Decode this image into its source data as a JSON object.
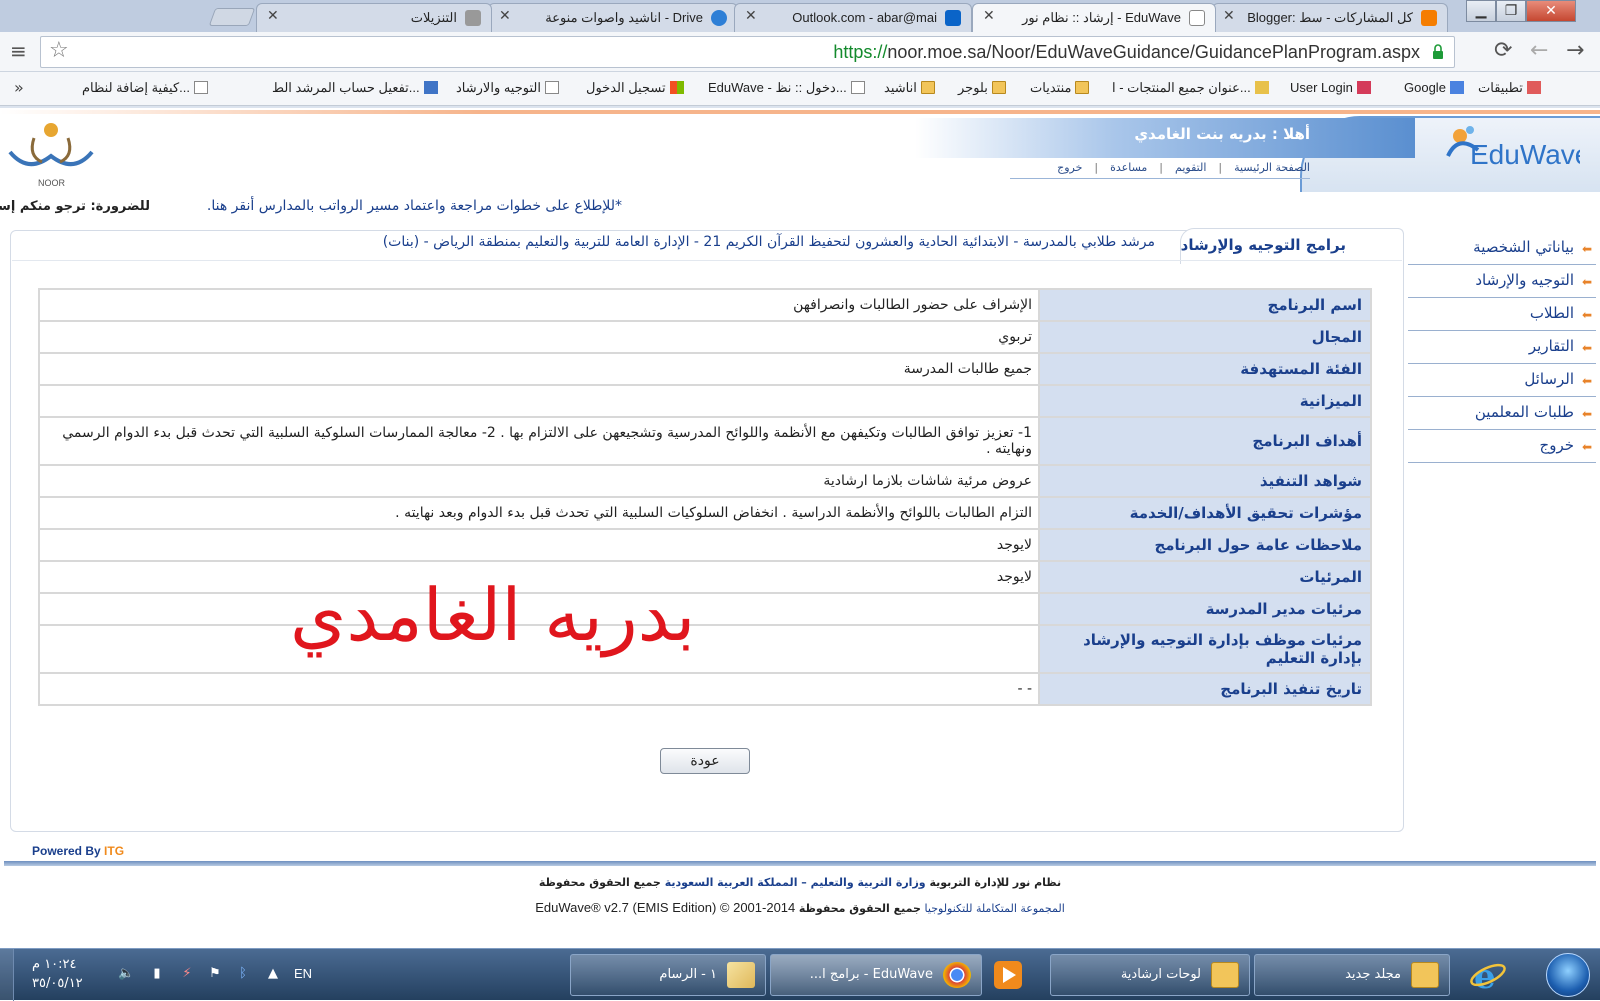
{
  "browser": {
    "tabs": [
      {
        "title": "Blogger: كل المشاركات - سط",
        "favicon_color": "#f57d00"
      },
      {
        "title": "إرشاد :: نظام نور - EduWave",
        "favicon_color": "#ffffff",
        "active": true
      },
      {
        "title": "Outlook.com - abar@mai",
        "favicon_color": "#0a64c8"
      },
      {
        "title": "اناشيد واصوات منوعة - Drive",
        "favicon_color": "#2e7fd6"
      },
      {
        "title": "التنزيلات",
        "favicon_color": "#666666"
      }
    ],
    "url_https": "https://",
    "url_rest": "noor.moe.sa/Noor/EduWaveGuidance/GuidancePlanProgram.aspx",
    "bookmarks": [
      "تطبيقات",
      "Google",
      "User Login",
      "عنوان جميع المنتجات - ا...",
      "منتديات",
      "بلوجر",
      "اناشيد",
      "EduWave - دخول :: نظ...",
      "تسجيل الدخول",
      "التوجيه والارشاد",
      "تفعيل حساب المرشد الط...",
      "كيفية إضافة لنظام..."
    ],
    "more": "»"
  },
  "header": {
    "welcome": "أهلا : بدريه بنت الغامدي",
    "nav": [
      "الصفحة الرئيسية",
      "التقويم",
      "مساعدة",
      "خروج"
    ],
    "eduwave_logo": "EduWave",
    "noor_logo": "NOOR"
  },
  "notice": {
    "right_text": "للضرورة: ترجو منكم إسنا",
    "link_text": "*للإطلاع على خطوات مراجعة واعتماد مسير الرواتب بالمدارس أنقر هنا."
  },
  "sidebar": {
    "items": [
      "بياناتي الشخصية",
      "التوجيه والإرشاد",
      "الطلاب",
      "التقارير",
      "الرسائل",
      "طلبات المعلمين",
      "خروج"
    ]
  },
  "panel": {
    "title": "برامج التوجيه والإرشاد",
    "subtitle": "مرشد طلابي بالمدرسة - الابتدائية الحادية والعشرون لتحفيظ القرآن الكريم 21 - الإدارة العامة للتربية والتعليم بمنطقة الرياض - (بنات)"
  },
  "details": [
    {
      "label": "اسم البرنامج",
      "value": "الإشراف على حضور الطالبات وانصرافهن"
    },
    {
      "label": "المجال",
      "value": "تربوي"
    },
    {
      "label": "الفئة المستهدفة",
      "value": "جميع طالبات المدرسة"
    },
    {
      "label": "الميزانية",
      "value": ""
    },
    {
      "label": "أهداف البرنامج",
      "value": "1- تعزيز توافق الطالبات وتكيفهن مع الأنظمة واللوائح المدرسية وتشجيعهن على الالتزام بها . 2- معالجة الممارسات السلوكية السلبية التي تحدث قبل بدء الدوام الرسمي ونهايته ."
    },
    {
      "label": "شواهد التنفيذ",
      "value": "عروض مرئية شاشات بلازما ارشادية"
    },
    {
      "label": "مؤشرات تحقيق الأهداف/الخدمة",
      "value": "التزام الطالبات باللوائح والأنظمة الدراسية . انخفاض السلوكيات السلبية التي تحدث قبل بدء الدوام وبعد نهايته ."
    },
    {
      "label": "ملاحظات عامة حول البرنامج",
      "value": "لايوجد"
    },
    {
      "label": "المرئيات",
      "value": "لايوجد"
    },
    {
      "label": "مرئيات مدير المدرسة",
      "value": ""
    },
    {
      "label": "مرئيات موظف بإدارة التوجيه والإرشاد بإدارة التعليم",
      "value": ""
    },
    {
      "label": "تاريخ تنفيذ البرنامج",
      "value": "- -"
    }
  ],
  "signature": "بدريه الغامدي",
  "back_button": "عودة",
  "footer": {
    "powered_by": "Powered By",
    "itg": "ITG",
    "line1_a": "نظام نور للإدارة التربوية",
    "line1_b": "وزارة التربية والتعليم – المملكة العربية السعودية",
    "line1_c": "جميع الحقوق محفوظة",
    "line2_a": "EduWave® v2.7 (EMIS Edition) © 2001-2014",
    "line2_b": "المجموعة المتكاملة للتكنولوجيا",
    "line2_c": "جميع الحقوق محفوظة"
  },
  "taskbar": {
    "buttons": [
      {
        "label": "مجلد جديد",
        "icon": "folder-icon"
      },
      {
        "label": "لوحات ارشادية",
        "icon": "folder-icon"
      },
      {
        "label": "EduWave - برامج ا...",
        "icon": "chrome-icon",
        "active": true
      },
      {
        "label": "١ - الرسام",
        "icon": "paint-icon"
      }
    ],
    "lang": "EN",
    "time": "١٠:٢٤ م",
    "date": "٣٥/٠٥/١٢"
  }
}
